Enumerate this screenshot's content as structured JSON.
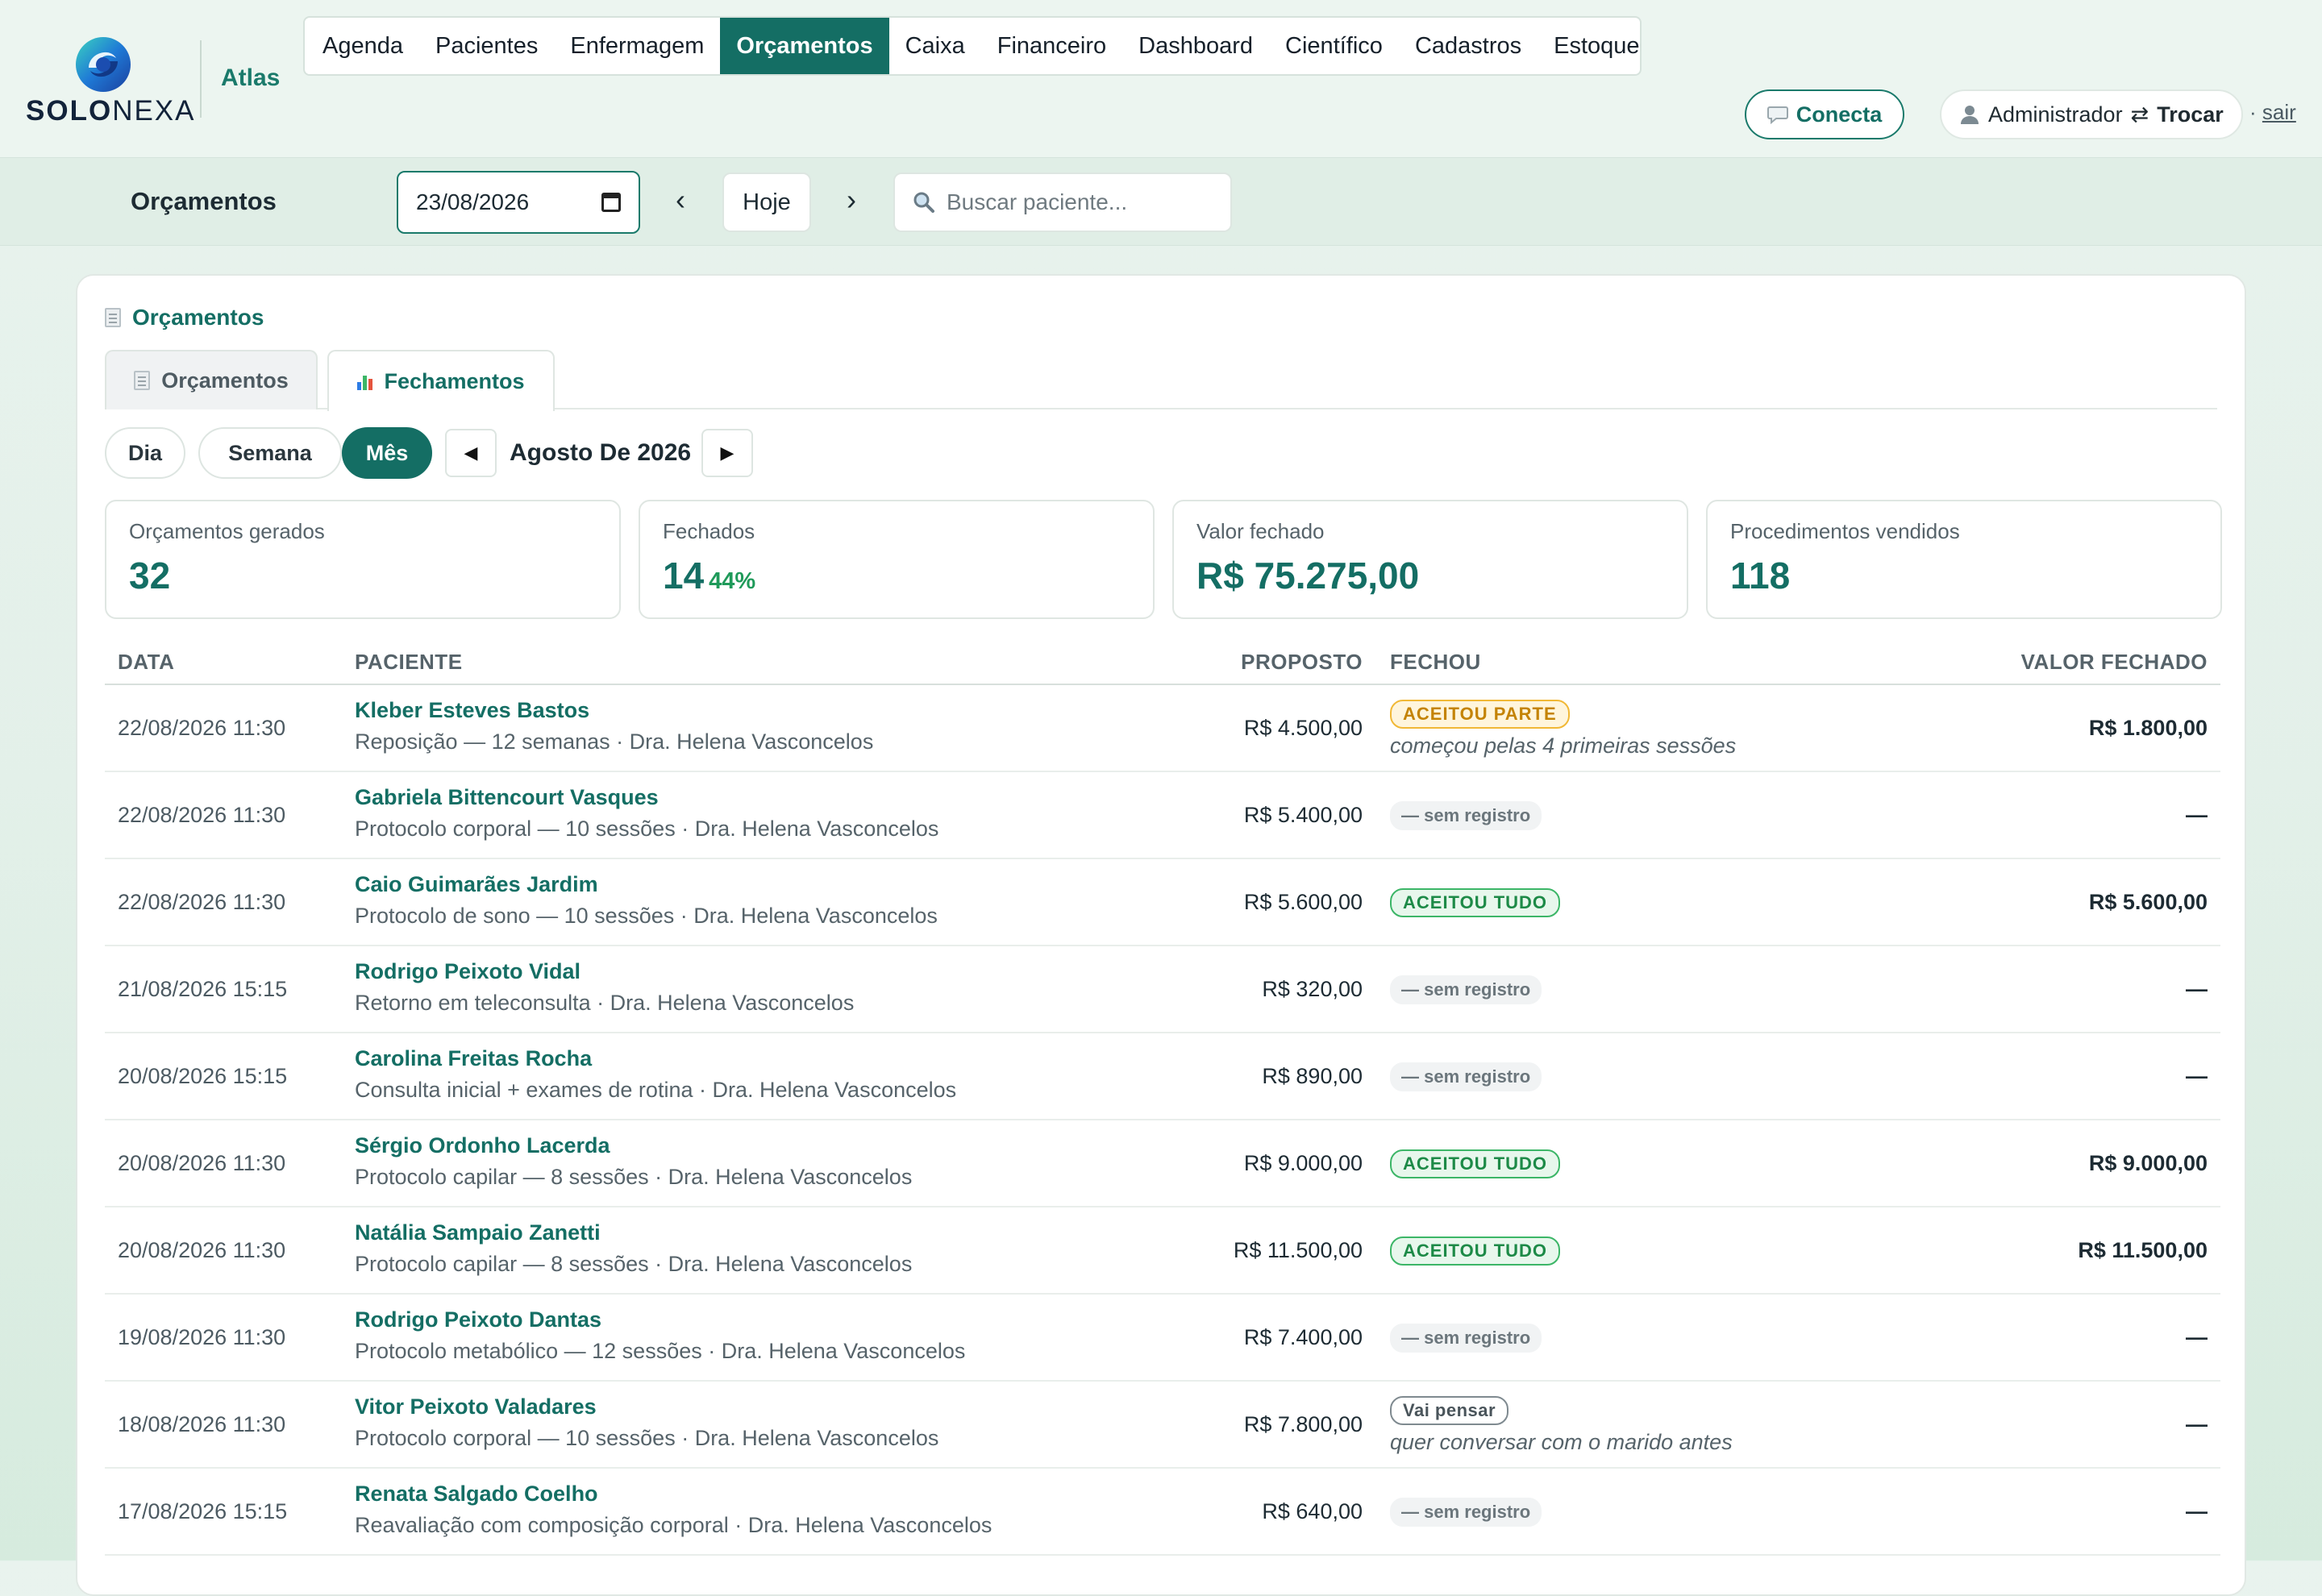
{
  "brand": {
    "name_bold": "SOLO",
    "name_rest": "NEXA",
    "app": "Atlas"
  },
  "nav": [
    {
      "label": "Agenda"
    },
    {
      "label": "Pacientes"
    },
    {
      "label": "Enfermagem"
    },
    {
      "label": "Orçamentos",
      "active": true
    },
    {
      "label": "Caixa"
    },
    {
      "label": "Financeiro"
    },
    {
      "label": "Dashboard"
    },
    {
      "label": "Científico"
    },
    {
      "label": "Cadastros"
    },
    {
      "label": "Estoque"
    }
  ],
  "header": {
    "conecta_label": "Conecta",
    "user_name": "Administrador",
    "switch_label": "Trocar",
    "separator": "·",
    "logout_label": "sair"
  },
  "subbar": {
    "title": "Orçamentos",
    "date": "23/08/2026",
    "prev": "‹",
    "today": "Hoje",
    "next": "›",
    "search_placeholder": "Buscar paciente..."
  },
  "card": {
    "title": "Orçamentos",
    "tabs": [
      {
        "label": "Orçamentos"
      },
      {
        "label": "Fechamentos"
      }
    ],
    "periods": [
      {
        "label": "Dia"
      },
      {
        "label": "Semana"
      },
      {
        "label": "Mês"
      }
    ],
    "month_label": "Agosto De 2026",
    "prev": "◀",
    "next": "▶"
  },
  "kpis": [
    {
      "label": "Orçamentos gerados",
      "value": "32"
    },
    {
      "label": "Fechados",
      "value": "14",
      "pct": "44%"
    },
    {
      "label": "Valor fechado",
      "value": "R$ 75.275,00"
    },
    {
      "label": "Procedimentos vendidos",
      "value": "118"
    }
  ],
  "table": {
    "headers": {
      "date": "DATA",
      "patient": "PACIENTE",
      "proposed": "PROPOSTO",
      "closed": "FECHOU",
      "value": "VALOR FECHADO"
    },
    "rows": [
      {
        "date": "22/08/2026 11:30",
        "name": "Kleber Esteves Bastos",
        "desc": "Reposição — 12 semanas · Dra. Helena Vasconcelos",
        "proposed": "R$ 4.500,00",
        "status": "ACEITOU PARTE",
        "status_type": "accepted-part",
        "note": "começou pelas 4 primeiras sessões",
        "value": "R$ 1.800,00"
      },
      {
        "date": "22/08/2026 11:30",
        "name": "Gabriela Bittencourt Vasques",
        "desc": "Protocolo corporal — 10 sessões · Dra. Helena Vasconcelos",
        "proposed": "R$ 5.400,00",
        "status": "— sem registro",
        "status_type": "none",
        "note": "",
        "value": "—"
      },
      {
        "date": "22/08/2026 11:30",
        "name": "Caio Guimarães Jardim",
        "desc": "Protocolo de sono — 10 sessões · Dra. Helena Vasconcelos",
        "proposed": "R$ 5.600,00",
        "status": "ACEITOU TUDO",
        "status_type": "accepted-all",
        "note": "",
        "value": "R$ 5.600,00"
      },
      {
        "date": "21/08/2026 15:15",
        "name": "Rodrigo Peixoto Vidal",
        "desc": "Retorno em teleconsulta · Dra. Helena Vasconcelos",
        "proposed": "R$ 320,00",
        "status": "— sem registro",
        "status_type": "none",
        "note": "",
        "value": "—"
      },
      {
        "date": "20/08/2026 15:15",
        "name": "Carolina Freitas Rocha",
        "desc": "Consulta inicial + exames de rotina · Dra. Helena Vasconcelos",
        "proposed": "R$ 890,00",
        "status": "— sem registro",
        "status_type": "none",
        "note": "",
        "value": "—"
      },
      {
        "date": "20/08/2026 11:30",
        "name": "Sérgio Ordonho Lacerda",
        "desc": "Protocolo capilar — 8 sessões · Dra. Helena Vasconcelos",
        "proposed": "R$ 9.000,00",
        "status": "ACEITOU TUDO",
        "status_type": "accepted-all",
        "note": "",
        "value": "R$ 9.000,00"
      },
      {
        "date": "20/08/2026 11:30",
        "name": "Natália Sampaio Zanetti",
        "desc": "Protocolo capilar — 8 sessões · Dra. Helena Vasconcelos",
        "proposed": "R$ 11.500,00",
        "status": "ACEITOU TUDO",
        "status_type": "accepted-all",
        "note": "",
        "value": "R$ 11.500,00"
      },
      {
        "date": "19/08/2026 11:30",
        "name": "Rodrigo Peixoto Dantas",
        "desc": "Protocolo metabólico — 12 sessões · Dra. Helena Vasconcelos",
        "proposed": "R$ 7.400,00",
        "status": "— sem registro",
        "status_type": "none",
        "note": "",
        "value": "—"
      },
      {
        "date": "18/08/2026 11:30",
        "name": "Vitor Peixoto Valadares",
        "desc": "Protocolo corporal — 10 sessões · Dra. Helena Vasconcelos",
        "proposed": "R$ 7.800,00",
        "status": "Vai pensar",
        "status_type": "thinking",
        "note": "quer conversar com o marido antes",
        "value": "—"
      },
      {
        "date": "17/08/2026 15:15",
        "name": "Renata Salgado Coelho",
        "desc": "Reavaliação com composição corporal · Dra. Helena Vasconcelos",
        "proposed": "R$ 640,00",
        "status": "— sem registro",
        "status_type": "none",
        "note": "",
        "value": "—"
      }
    ]
  }
}
